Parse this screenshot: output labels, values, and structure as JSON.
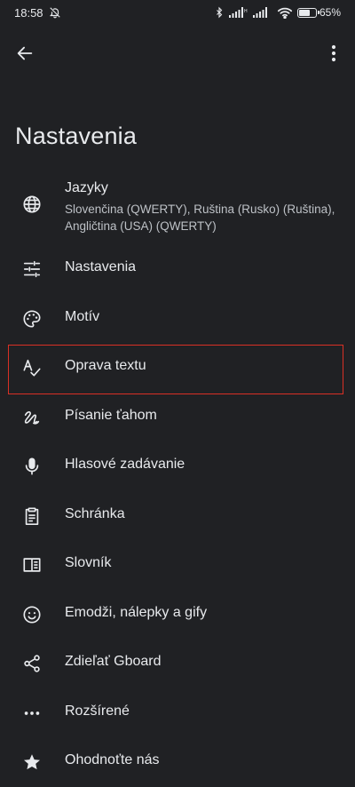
{
  "status_bar": {
    "time": "18:58",
    "battery_percent": 65,
    "battery_text": "65%",
    "icons": [
      "mute-notifications-icon",
      "bluetooth-icon",
      "signal-icon",
      "signal-icon",
      "wifi-icon",
      "battery-icon"
    ]
  },
  "app_bar": {
    "back_icon": "arrow-back-icon",
    "more_icon": "more-vert-icon"
  },
  "page": {
    "title": "Nastavenia"
  },
  "settings": {
    "items": [
      {
        "label": "Jazyky",
        "subtitle": "Slovenčina (QWERTY), Ruština (Rusko) (Ruština), Angličtina (USA) (QWERTY)",
        "icon": "globe-icon"
      },
      {
        "label": "Nastavenia",
        "icon": "tune-icon"
      },
      {
        "label": "Motív",
        "icon": "palette-icon"
      },
      {
        "label": "Oprava textu",
        "icon": "spellcheck-icon",
        "highlighted": true
      },
      {
        "label": "Písanie ťahom",
        "icon": "gesture-icon"
      },
      {
        "label": "Hlasové zadávanie",
        "icon": "mic-icon"
      },
      {
        "label": "Schránka",
        "icon": "clipboard-icon"
      },
      {
        "label": "Slovník",
        "icon": "dictionary-icon"
      },
      {
        "label": "Emodži, nálepky a gify",
        "icon": "emoji-icon"
      },
      {
        "label": "Zdieľať Gboard",
        "icon": "share-icon"
      },
      {
        "label": "Rozšírené",
        "icon": "more-horiz-icon"
      },
      {
        "label": "Ohodnoťte nás",
        "icon": "star-icon"
      }
    ]
  },
  "colors": {
    "background": "#202124",
    "text_primary": "#e8eaed",
    "text_secondary": "#bdc1c6",
    "highlight": "#d93025"
  }
}
